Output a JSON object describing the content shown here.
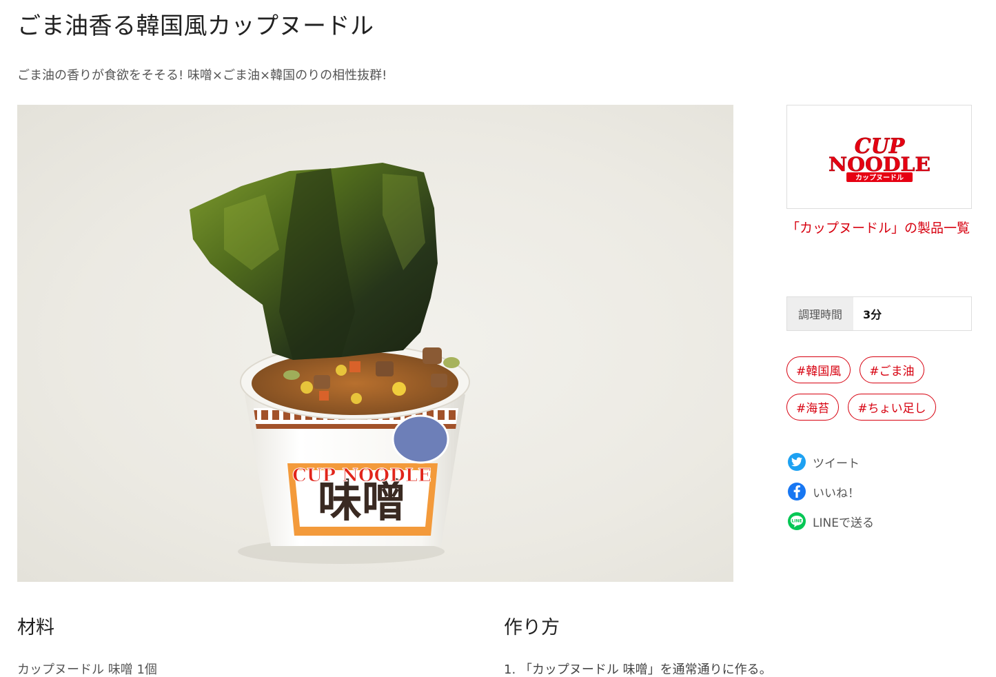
{
  "header": {
    "title": "ごま油香る韓国風カップヌードル",
    "subtitle": "ごま油の香りが食欲をそそる! 味噌×ごま油×韓国のりの相性抜群!"
  },
  "sidebar": {
    "brand_link": "「カップヌードル」の製品一覧",
    "cook_time_label": "調理時間",
    "cook_time_value": "3分",
    "tags": [
      "#韓国風",
      "#ごま油",
      "#海苔",
      "#ちょい足し"
    ],
    "share": {
      "tweet": "ツイート",
      "like": "いいね！",
      "line": "LINEで送る"
    }
  },
  "ingredients": {
    "heading": "材料",
    "items": [
      "カップヌードル 味噌 1個"
    ]
  },
  "steps": {
    "heading": "作り方",
    "items": [
      "1. 「カップヌードル 味噌」を通常通りに作る。"
    ]
  },
  "colors": {
    "accent": "#d7000f",
    "twitter": "#1da1f2",
    "facebook": "#1877f2",
    "line": "#06c755"
  }
}
